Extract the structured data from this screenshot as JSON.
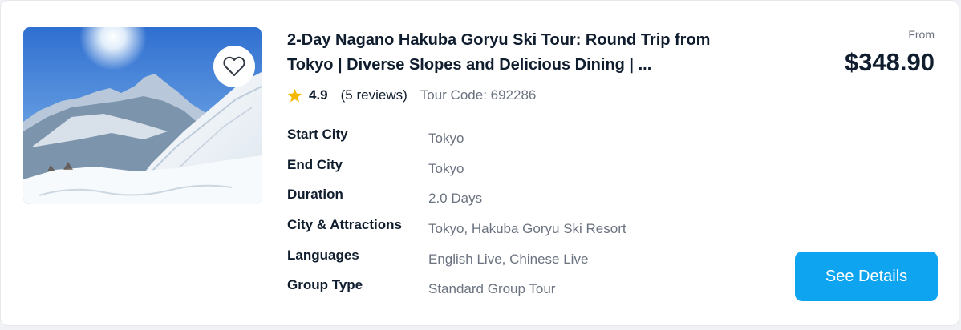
{
  "tour": {
    "title": "2-Day Nagano Hakuba Goryu Ski Tour: Round Trip from Tokyo | Diverse Slopes and Delicious Dining | ...",
    "rating": {
      "score": "4.9",
      "reviews": "(5 reviews)",
      "tour_code": "Tour Code: 692286"
    },
    "details": [
      {
        "label": "Start City",
        "value": "Tokyo"
      },
      {
        "label": "End City",
        "value": "Tokyo"
      },
      {
        "label": "Duration",
        "value": "2.0 Days"
      },
      {
        "label": "City & Attractions",
        "value": "Tokyo, Hakuba Goryu Ski Resort"
      },
      {
        "label": "Languages",
        "value": "English Live, Chinese Live"
      },
      {
        "label": "Group Type",
        "value": "Standard Group Tour"
      }
    ],
    "price": {
      "prefix": "From",
      "amount": "$348.90"
    },
    "cta_label": "See Details"
  },
  "icons": {
    "favorite": "heart-outline-icon",
    "rating": "star-icon"
  },
  "colors": {
    "accent": "#0ea4f0",
    "star": "#f5b800",
    "text_primary": "#0f1d2e",
    "text_secondary": "#6b7380"
  }
}
